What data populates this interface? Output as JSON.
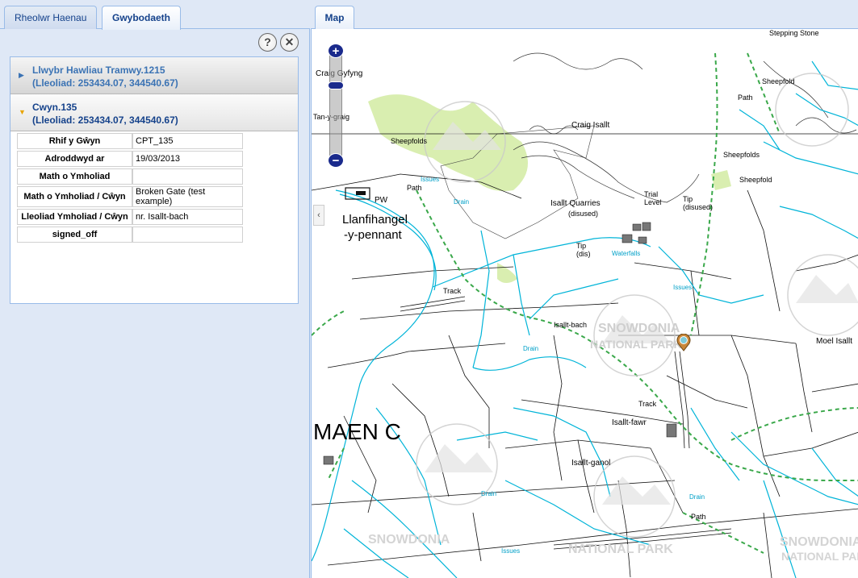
{
  "left_tabs": [
    "Rheolwr Haenau",
    "Gwybodaeth"
  ],
  "tools": {
    "help_icon": "?",
    "close_icon": "✕"
  },
  "accordion": [
    {
      "title": "Llwybr Hawliau Tramwy.1215",
      "location": "(Lleoliad: 253434.07, 344540.67)",
      "expanded": false
    },
    {
      "title": "Cwyn.135",
      "location": "(Lleoliad: 253434.07, 344540.67)",
      "expanded": true
    }
  ],
  "properties": [
    {
      "key": "Rhif y Gŵyn",
      "value": "CPT_135"
    },
    {
      "key": "Adroddwyd ar",
      "value": "19/03/2013"
    },
    {
      "key": "Math o Ymholiad",
      "value": ""
    },
    {
      "key": "Math o Ymholiad / Cŵyn",
      "value": "Broken Gate (test example)"
    },
    {
      "key": "Lleoliad Ymholiad / Cŵyn",
      "value": "nr. Isallt-bach"
    },
    {
      "key": "signed_off",
      "value": ""
    }
  ],
  "map": {
    "tab_label": "Map",
    "zoom_in": "+",
    "zoom_out": "−",
    "collapse": "‹",
    "labels": {
      "craig_gyfyng": "Craig Gyfyng",
      "tan_y_graig": "Tan-y-graig",
      "craig_isallt": "Craig Isallt",
      "sheepfolds1": "Sheepfolds",
      "sheepfolds2": "Sheepfolds",
      "sheepfold1": "Sheepfold",
      "sheepfold2": "Sheepfold",
      "stepping_stone": "Stepping Stone",
      "path": "Path",
      "pw": "PW",
      "llanfihangel": "Llanfihangel",
      "y_pennant": "-y-pennant",
      "isallt_quarries": "Isallt Quarries",
      "disused": "(disused)",
      "trial_level": "Trial Level",
      "tip_disused": "Tip (disused)",
      "tip_dis": "Tip (dis)",
      "waterfalls": "Waterfalls",
      "issues": "Issues",
      "drain": "Drain",
      "track": "Track",
      "isallt_bach": "Isallt-bach",
      "isallt_fawr": "Isallt-fawr",
      "isallt_ganol": "Isallt-ganol",
      "moel_isallt": "Moel Isallt",
      "maen_c": "MAEN C",
      "snowdonia": "SNOWDONIA",
      "national_park": "NATIONAL PARK"
    }
  },
  "colors": {
    "accent": "#15428b",
    "water": "#00b4d8",
    "path": "#2ca02c",
    "woodland": "#d9eeb0"
  }
}
